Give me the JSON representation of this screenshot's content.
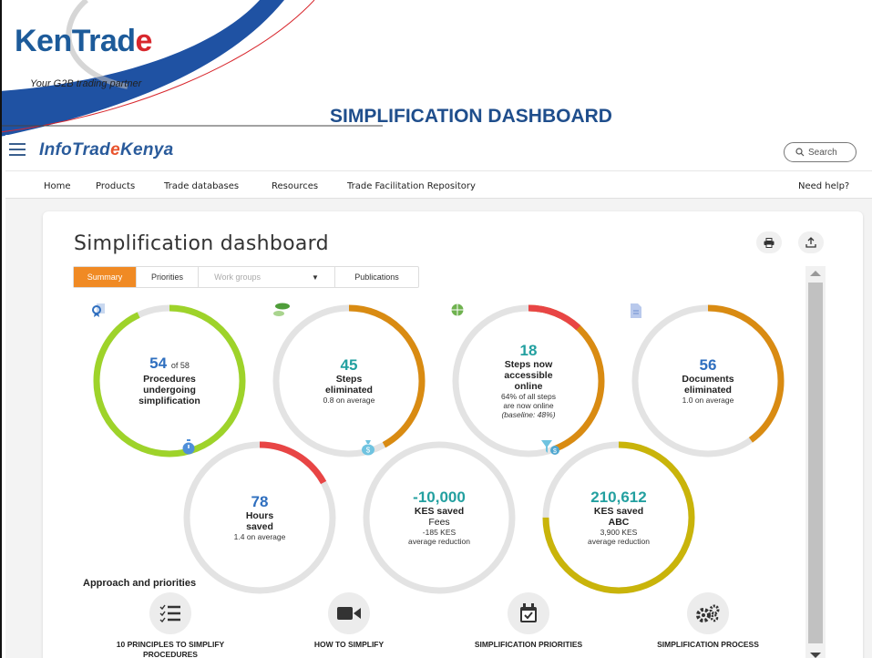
{
  "slide": {
    "logo_main": "KenTrad",
    "logo_accent": "e",
    "tagline": "Your G2B trading partner",
    "title": "SIMPLIFICATION DASHBOARD"
  },
  "header": {
    "brand_main": "InfoTrad",
    "brand_o": "e",
    "brand_end": "Kenya",
    "search_label": "Search"
  },
  "nav": {
    "items": [
      "Home",
      "Products",
      "Trade databases",
      "Resources",
      "Trade Facilitation Repository",
      "Need help?"
    ]
  },
  "card": {
    "title": "Simplification dashboard"
  },
  "tabs": {
    "summary": "Summary",
    "priorities": "Priorities",
    "workgroups": "Work groups",
    "publications": "Publications"
  },
  "stats": [
    {
      "value": "54",
      "value_suffix": "of 58",
      "label1": "Procedures",
      "label2": "undergoing",
      "label3": "simplification",
      "sub": "",
      "progress": 0.93,
      "color": "#9ed32a"
    },
    {
      "value": "45",
      "label1": "Steps",
      "label2": "eliminated",
      "sub": "0.8 on average",
      "progress": 0.42,
      "color": "#d98b12"
    },
    {
      "value": "18",
      "label1": "Steps now",
      "label2": "accessible",
      "label3": "online",
      "sub": "64% of all steps",
      "sub2": "are now online",
      "sub3": "(baseline: 48%)",
      "progress": 0.12,
      "progress2": 0.44,
      "color": "#e84545",
      "color2": "#d98b12"
    },
    {
      "value": "56",
      "label1": "Documents",
      "label2": "eliminated",
      "sub": "1.0 on average",
      "progress": 0.4,
      "color": "#d98b12"
    },
    {
      "value": "78",
      "label1": "Hours",
      "label2": "saved",
      "sub": "1.4 on average",
      "progress": 0.17,
      "color": "#e84545"
    },
    {
      "value": "-10,000",
      "label1": "KES saved",
      "label2": "Fees",
      "sub": "-185 KES",
      "sub2": "average reduction",
      "progress": 0.0,
      "color": "#d98b12"
    },
    {
      "value": "210,612",
      "label1": "KES saved",
      "label2": "ABC",
      "sub": "3,900 KES",
      "sub2": "average reduction",
      "progress": 0.75,
      "color": "#c9b40a"
    }
  ],
  "approach": {
    "title": "Approach and priorities",
    "items": [
      {
        "label1": "10 PRINCIPLES TO SIMPLIFY",
        "label2": "PROCEDURES"
      },
      {
        "label1": "HOW TO SIMPLIFY",
        "label2": ""
      },
      {
        "label1": "SIMPLIFICATION PRIORITIES",
        "label2": ""
      },
      {
        "label1": "SIMPLIFICATION PROCESS",
        "label2": ""
      }
    ]
  }
}
